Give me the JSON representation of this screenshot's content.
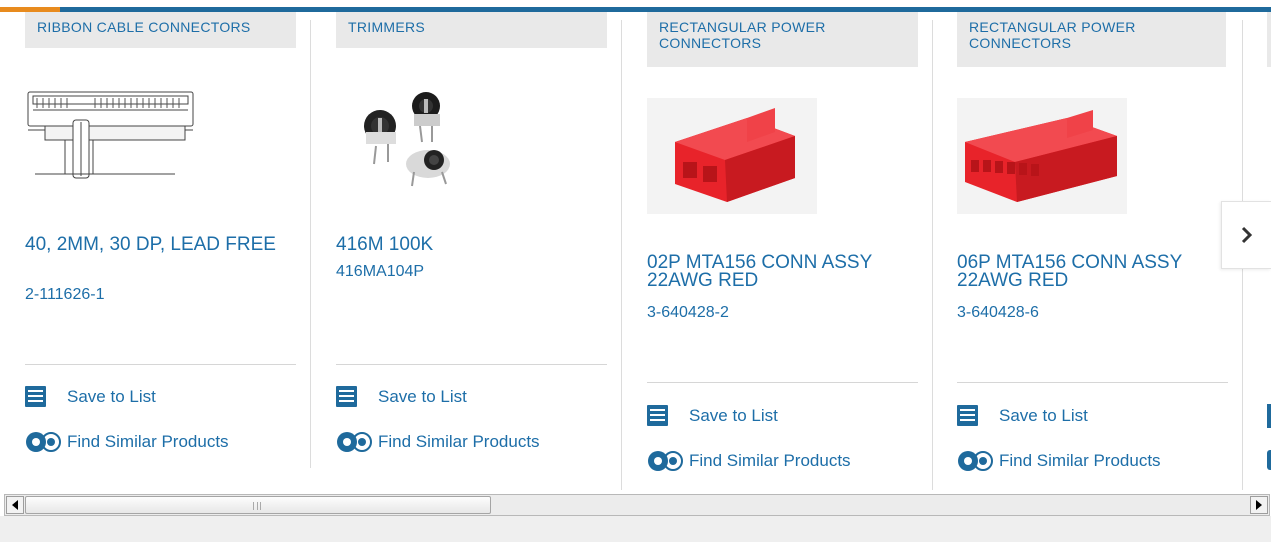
{
  "colors": {
    "accent": "#1d6ea8",
    "top_bar": "#1f6a9c",
    "top_bar_accent": "#e88b1e",
    "category_bg": "#e9e9e9",
    "connector_red": "#e8232a"
  },
  "cards": [
    {
      "category": "RIBBON CABLE CONNECTORS",
      "image": "ribbon-cable-connector-drawing",
      "title": "40, 2MM, 30 DP, LEAD FREE",
      "part_number": "2-111626-1",
      "save_label": "Save to List",
      "similar_label": "Find Similar Products"
    },
    {
      "category": "TRIMMERS",
      "image": "trimmer-potentiometers-photo",
      "title": "416M 100K",
      "part_number": "416MA104P",
      "save_label": "Save to List",
      "similar_label": "Find Similar Products"
    },
    {
      "category": "RECTANGULAR POWER CONNECTORS",
      "image": "red-2-position-connector-photo",
      "title": "02P MTA156 CONN ASSY 22AWG RED",
      "part_number": "3-640428-2",
      "save_label": "Save to List",
      "similar_label": "Find Similar Products"
    },
    {
      "category": "RECTANGULAR POWER CONNECTORS",
      "image": "red-6-position-connector-photo",
      "title": "06P MTA156 CONN ASSY 22AWG RED",
      "part_number": "3-640428-6",
      "save_label": "Save to List",
      "similar_label": "Find Similar Products"
    }
  ],
  "carousel": {
    "next_icon": "chevron-right-icon"
  },
  "scrollbar": {
    "left_icon": "arrow-left-icon",
    "right_icon": "arrow-right-icon"
  }
}
